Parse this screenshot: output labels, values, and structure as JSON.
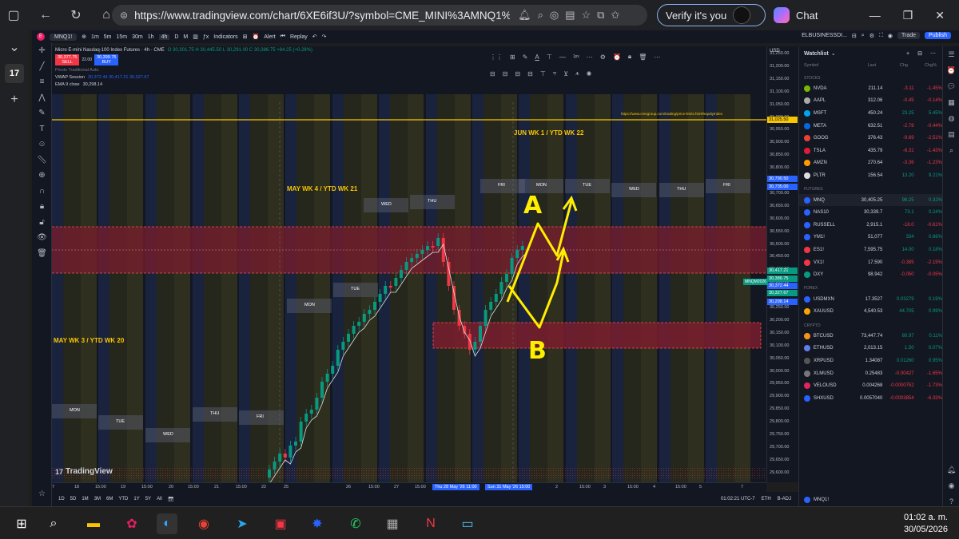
{
  "browser": {
    "url": "https://www.tradingview.com/chart/6XE6if3U/?symbol=CME_MINI%3AMNQ1%21",
    "verify_label": "Verify it's you",
    "chat_label": "Chat"
  },
  "toolbar": {
    "symbol": "MNQ1!",
    "timeframes": [
      "1m",
      "5m",
      "15m",
      "30m",
      "1h",
      "4h",
      "D",
      "M"
    ],
    "indicators": "Indicators",
    "alert": "Alert",
    "replay": "Replay",
    "account": "ELBUSINESSDI...",
    "trade": "Trade",
    "publish": "Publish"
  },
  "legend": {
    "title": "Micro E-mini Nasdaq-100 Index Futures · 4h · CME",
    "ohlc": "O 30,301.75  H 30,445.50  L 30,291.00  C 30,386.75  +84.25 (+0.28%)",
    "sell_price": "30,377.75",
    "sell_label": "SELL",
    "spread": "22.00",
    "buy_price": "30,399.75",
    "buy_label": "BUY",
    "pivots": "Pivots Traditional Auto",
    "vwap": "VWAP Session",
    "vwap_values": "30,372.44  30,417.21  30,327.67",
    "ema_label": "EMA 9 close",
    "ema_value": "30,298.14"
  },
  "chart_labels": {
    "may_wk3": "MAY WK 3 / YTD WK 20",
    "may_wk4": "MAY WK 4 / YTD WK 21",
    "jun_wk1": "JUN WK 1 / YTD WK 22",
    "link": "https://www.cmegroup.com/trading/price-limits.html#equityIndex",
    "annot_a": "A",
    "annot_b": "B",
    "watermark": "TradingView",
    "days": [
      "MON",
      "TUE",
      "WED",
      "THU",
      "FRI"
    ]
  },
  "price_axis": {
    "currency": "USD",
    "ticks": [
      "31,250.00",
      "31,200.00",
      "31,150.00",
      "31,100.00",
      "31,050.00",
      "31,000.00",
      "30,950.00",
      "30,900.00",
      "30,850.00",
      "30,800.00",
      "30,750.00",
      "30,700.00",
      "30,650.00",
      "30,600.00",
      "30,550.00",
      "30,500.00",
      "30,450.00",
      "30,400.00",
      "30,350.00",
      "30,300.00",
      "30,250.00",
      "30,200.00",
      "30,150.00",
      "30,100.00",
      "30,050.00",
      "30,000.00",
      "29,950.00",
      "29,900.00",
      "29,850.00",
      "29,800.00",
      "29,750.00",
      "29,700.00",
      "29,650.00",
      "29,600.00"
    ],
    "labels": [
      {
        "text": "31,025.50",
        "color": "#f7c600"
      },
      {
        "text": "30,790.50",
        "color": "#2962ff"
      },
      {
        "text": "30,735.00",
        "color": "#2962ff"
      },
      {
        "text": "30,417.21",
        "color": "#089981"
      },
      {
        "text": "30,386.75",
        "color": "#089981"
      },
      {
        "text": "30,372.44",
        "color": "#2962ff"
      },
      {
        "text": "30,327.67",
        "color": "#089981"
      },
      {
        "text": "30,298.14",
        "color": "#2962ff"
      }
    ],
    "symbol_tag": "MNQM2026"
  },
  "time_axis": {
    "ticks": [
      "7",
      "18",
      "15:00",
      "19",
      "15:00",
      "20",
      "15:00",
      "21",
      "15:00",
      "22",
      "25",
      "26",
      "15:00",
      "27",
      "15:00",
      "15:00",
      "2",
      "15:00",
      "3",
      "15:00",
      "4",
      "15:00",
      "5",
      "7"
    ],
    "highlight1": "Thu 28 May '26  11:00",
    "highlight2": "Sun 31 May '26  15:00"
  },
  "bottom": {
    "ranges": [
      "1D",
      "5D",
      "1M",
      "3M",
      "6M",
      "YTD",
      "1Y",
      "5Y",
      "All"
    ],
    "time": "01:02:21 UTC-7",
    "eth": "ETH",
    "badj": "B-ADJ"
  },
  "watchlist": {
    "title": "Watchlist",
    "cols": [
      "Symbol",
      "Last",
      "Chg",
      "Chg%"
    ],
    "sections": [
      {
        "name": "STOCKS",
        "rows": [
          {
            "s": "NVDA",
            "l": "211.14",
            "c": "-3.11",
            "p": "-1.45%",
            "color": "#76b900",
            "up": false
          },
          {
            "s": "AAPL",
            "l": "312.06",
            "c": "-0.45",
            "p": "-0.14%",
            "color": "#aaaaaa",
            "up": false
          },
          {
            "s": "MSFT",
            "l": "450.24",
            "c": "23.25",
            "p": "5.45%",
            "color": "#00a4ef",
            "up": true
          },
          {
            "s": "META",
            "l": "632.51",
            "c": "-2.78",
            "p": "-0.44%",
            "color": "#0668e1",
            "up": false
          },
          {
            "s": "GOOG",
            "l": "376.43",
            "c": "-9.69",
            "p": "-2.51%",
            "color": "#ea4335",
            "up": false
          },
          {
            "s": "TSLA",
            "l": "435.79",
            "c": "-6.31",
            "p": "-1.43%",
            "color": "#e31937",
            "up": false
          },
          {
            "s": "AMZN",
            "l": "270.64",
            "c": "-3.36",
            "p": "-1.23%",
            "color": "#ff9900",
            "up": false
          },
          {
            "s": "PLTR",
            "l": "156.54",
            "c": "13.20",
            "p": "9.21%",
            "color": "#dddddd",
            "up": true
          }
        ]
      },
      {
        "name": "FUTURES",
        "rows": [
          {
            "s": "MNQ",
            "l": "30,405.25",
            "c": "98.25",
            "p": "0.32%",
            "color": "#2962ff",
            "up": true,
            "sel": true
          },
          {
            "s": "NAS10",
            "l": "30,339.7",
            "c": "73.1",
            "p": "0.24%",
            "color": "#2962ff",
            "up": true
          },
          {
            "s": "RUSSELL",
            "l": "2,915.1",
            "c": "-18.0",
            "p": "-0.61%",
            "color": "#2962ff",
            "up": false
          },
          {
            "s": "YM1!",
            "l": "51,077",
            "c": "334",
            "p": "0.66%",
            "color": "#2962ff",
            "up": true
          },
          {
            "s": "ES1!",
            "l": "7,595.75",
            "c": "14.00",
            "p": "0.18%",
            "color": "#f23645",
            "up": true
          },
          {
            "s": "VX1!",
            "l": "17.590",
            "c": "-0.385",
            "p": "-2.15%",
            "color": "#f23645",
            "up": false
          },
          {
            "s": "DXY",
            "l": "98.942",
            "c": "-0.050",
            "p": "-0.05%",
            "color": "#089981",
            "up": false
          }
        ]
      },
      {
        "name": "FOREX",
        "rows": [
          {
            "s": "USDMXN",
            "l": "17.3527",
            "c": "0.03279",
            "p": "0.19%",
            "color": "#2962ff",
            "up": true
          },
          {
            "s": "XAUUSD",
            "l": "4,540.53",
            "c": "44.705",
            "p": "0.99%",
            "color": "#f7a600",
            "up": true
          }
        ]
      },
      {
        "name": "CRYPTO",
        "rows": [
          {
            "s": "BTCUSD",
            "l": "73,447.74",
            "c": "80.97",
            "p": "0.11%",
            "color": "#f7931a",
            "up": true
          },
          {
            "s": "ETHUSD",
            "l": "2,013.15",
            "c": "1.50",
            "p": "0.07%",
            "color": "#627eea",
            "up": true
          },
          {
            "s": "XRPUSD",
            "l": "1.34087",
            "c": "0.01260",
            "p": "0.95%",
            "color": "#555555",
            "up": true
          },
          {
            "s": "XLMUSD",
            "l": "0.25483",
            "c": "-0.00427",
            "p": "-1.65%",
            "color": "#777777",
            "up": false
          },
          {
            "s": "VELOUSD",
            "l": "0.004268",
            "c": "-0.0000752",
            "p": "-1.73%",
            "color": "#e0245e",
            "up": false
          },
          {
            "s": "SHXUSD",
            "l": "0.0057040",
            "c": "-0.0003854",
            "p": "-6.33%",
            "color": "#2962ff",
            "up": false
          }
        ]
      }
    ],
    "footer_symbol": "MNQ1!"
  },
  "taskbar": {
    "time": "01:02 a. m.",
    "date": "30/05/2026"
  }
}
